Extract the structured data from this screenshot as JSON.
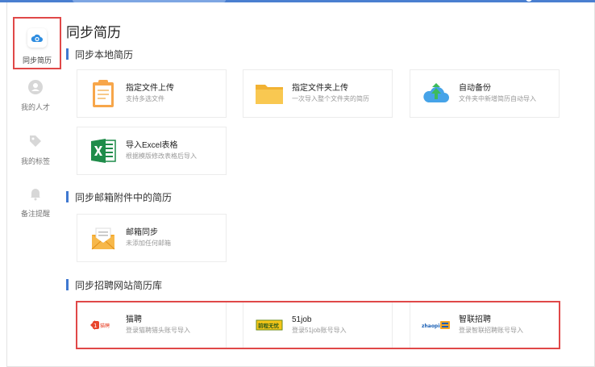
{
  "sidebar": {
    "items": [
      {
        "label": "同步简历",
        "icon": "cloud-sync-icon",
        "active": true
      },
      {
        "label": "我的人才",
        "icon": "person-icon",
        "active": false
      },
      {
        "label": "我的标签",
        "icon": "tag-icon",
        "active": false
      },
      {
        "label": "备注提醒",
        "icon": "bell-icon",
        "active": false
      }
    ]
  },
  "page": {
    "title": "同步简历"
  },
  "sections": {
    "local": {
      "title": "同步本地简历",
      "cards": [
        {
          "title": "指定文件上传",
          "subtitle": "支持多选文件",
          "icon": "clipboard-file-icon"
        },
        {
          "title": "指定文件夹上传",
          "subtitle": "一次导入整个文件夹的简历",
          "icon": "folder-icon"
        },
        {
          "title": "自动备份",
          "subtitle": "文件夹中新增简历自动导入",
          "icon": "cloud-upload-icon"
        },
        {
          "title": "导入Excel表格",
          "subtitle": "根据模版修改表格后导入",
          "icon": "excel-icon"
        }
      ]
    },
    "mail": {
      "title": "同步邮箱附件中的简历",
      "cards": [
        {
          "title": "邮箱同步",
          "subtitle": "未添加任何邮箱",
          "icon": "envelope-icon"
        }
      ]
    },
    "site": {
      "title": "同步招聘网站简历库",
      "cards": [
        {
          "title": "猫聘",
          "subtitle": "登录猫聘猎头账号导入",
          "icon": "maopin-logo-icon",
          "logo_text": "猫聘"
        },
        {
          "title": "51job",
          "subtitle": "登录51job账号导入",
          "icon": "51job-logo-icon",
          "logo_text": "前程无忧"
        },
        {
          "title": "智联招聘",
          "subtitle": "登录智联招聘账号导入",
          "icon": "zhaopin-logo-icon",
          "logo_text": "zhaopin"
        }
      ]
    }
  },
  "colors": {
    "accent": "#3f78d0",
    "highlight": "#e04848",
    "topbar": "#4a7fd0"
  }
}
